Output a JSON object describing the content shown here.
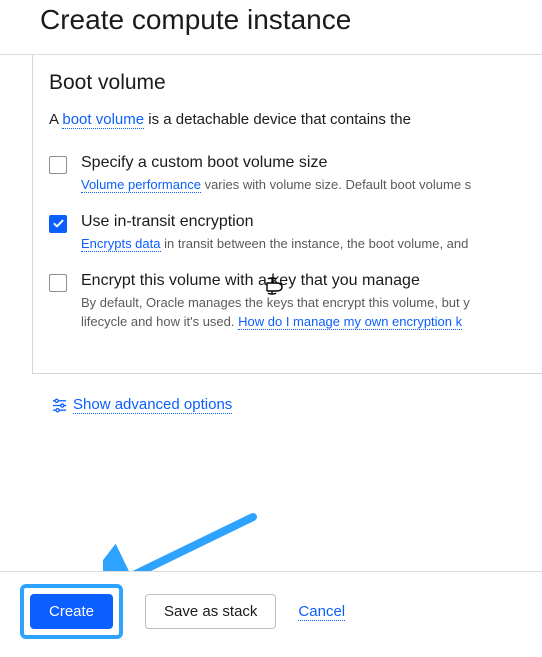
{
  "header": {
    "title": "Create compute instance"
  },
  "section": {
    "title": "Boot volume",
    "intro_prefix": "A ",
    "intro_link": "boot volume",
    "intro_suffix": " is a detachable device that contains the"
  },
  "options": [
    {
      "label": "Specify a custom boot volume size",
      "checked": false,
      "desc_link": "Volume performance",
      "desc_rest": " varies with volume size. Default boot volume s"
    },
    {
      "label": "Use in-transit encryption",
      "checked": true,
      "desc_link": "Encrypts data",
      "desc_rest": " in transit between the instance, the boot volume, and"
    },
    {
      "label": "Encrypt this volume with a key that you manage",
      "checked": false,
      "desc_pre": "By default, Oracle manages the keys that encrypt this volume, but y",
      "desc_pre2": "lifecycle and how it's used. ",
      "desc_link2": "How do I manage my own encryption k"
    }
  ],
  "advanced": {
    "label": "Show advanced options"
  },
  "footer": {
    "create": "Create",
    "save_stack": "Save as stack",
    "cancel": "Cancel"
  }
}
